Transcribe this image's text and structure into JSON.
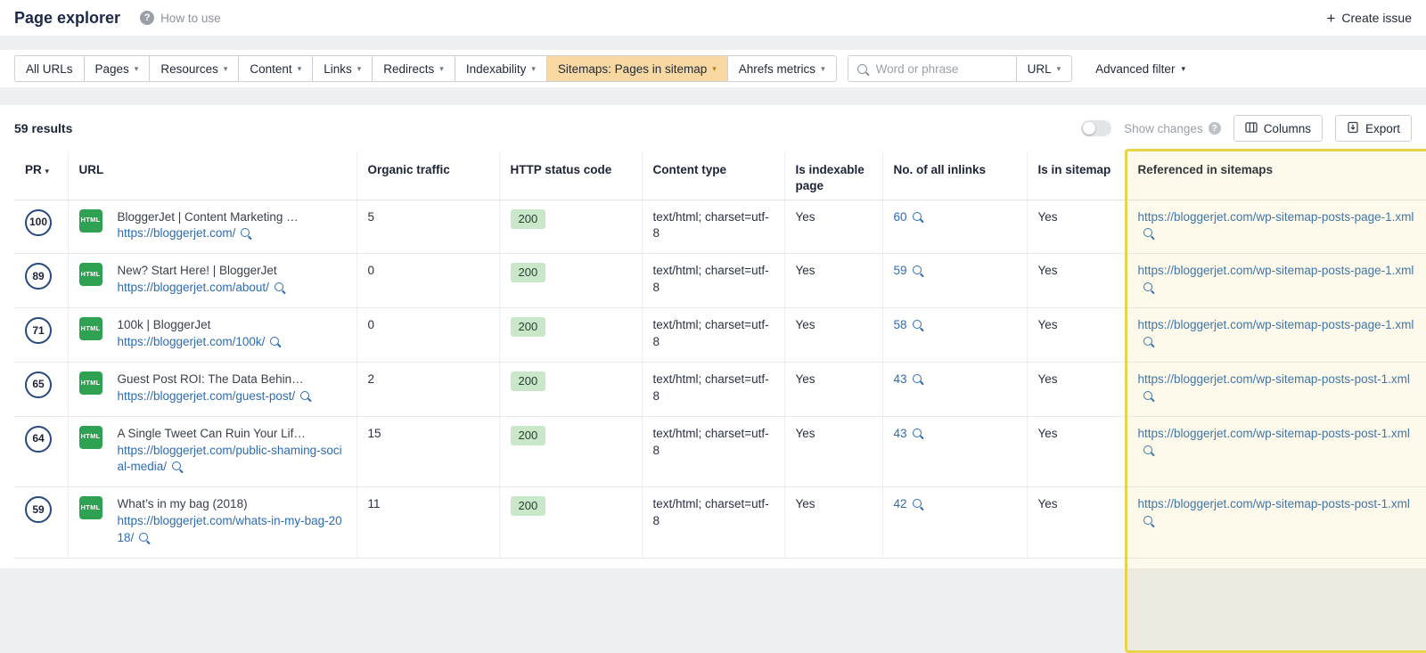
{
  "page": {
    "title": "Page explorer",
    "help_label": "How to use",
    "create_issue_label": "Create issue"
  },
  "filter_bar": {
    "segments": [
      {
        "label": "All URLs",
        "dropdown": false,
        "active": false
      },
      {
        "label": "Pages",
        "dropdown": true,
        "active": false
      },
      {
        "label": "Resources",
        "dropdown": true,
        "active": false
      },
      {
        "label": "Content",
        "dropdown": true,
        "active": false
      },
      {
        "label": "Links",
        "dropdown": true,
        "active": false
      },
      {
        "label": "Redirects",
        "dropdown": true,
        "active": false
      },
      {
        "label": "Indexability",
        "dropdown": true,
        "active": false
      },
      {
        "label": "Sitemaps: Pages in sitemap",
        "dropdown": true,
        "active": true
      },
      {
        "label": "Ahrefs metrics",
        "dropdown": true,
        "active": false
      }
    ],
    "search_placeholder": "Word or phrase",
    "url_scope_label": "URL",
    "advanced_filter_label": "Advanced filter"
  },
  "results_bar": {
    "count": "59 results",
    "show_changes_label": "Show changes",
    "columns_label": "Columns",
    "export_label": "Export"
  },
  "icons": {
    "html_badge": "HTML"
  },
  "colors": {
    "active_filter_bg": "#f8d9a3",
    "status_ok_bg": "#c9e7c9",
    "link_blue": "#2d6cb5",
    "highlight_border": "#e8d44a",
    "html_icon_green": "#2fa152"
  },
  "table": {
    "headers": {
      "pr": "PR",
      "url": "URL",
      "organic_traffic": "Organic traffic",
      "http_status": "HTTP status code",
      "content_type": "Content type",
      "is_indexable": "Is indexable page",
      "inlinks": "No. of all inlinks",
      "in_sitemap": "Is in sitemap",
      "referenced": "Referenced in sitemaps"
    },
    "rows": [
      {
        "pr": "100",
        "title": "BloggerJet | Content Marketing …",
        "url": "https://bloggerjet.com/",
        "traffic": "5",
        "status": "200",
        "content_type": "text/html; charset=utf-8",
        "indexable": "Yes",
        "inlinks": "60",
        "in_sitemap": "Yes",
        "sitemap_url": "https://bloggerjet.com/wp-sitemap-posts-page-1.xml"
      },
      {
        "pr": "89",
        "title": "New? Start Here! | BloggerJet",
        "url": "https://bloggerjet.com/about/",
        "traffic": "0",
        "status": "200",
        "content_type": "text/html; charset=utf-8",
        "indexable": "Yes",
        "inlinks": "59",
        "in_sitemap": "Yes",
        "sitemap_url": "https://bloggerjet.com/wp-sitemap-posts-page-1.xml"
      },
      {
        "pr": "71",
        "title": "100k | BloggerJet",
        "url": "https://bloggerjet.com/100k/",
        "traffic": "0",
        "status": "200",
        "content_type": "text/html; charset=utf-8",
        "indexable": "Yes",
        "inlinks": "58",
        "in_sitemap": "Yes",
        "sitemap_url": "https://bloggerjet.com/wp-sitemap-posts-page-1.xml"
      },
      {
        "pr": "65",
        "title": "Guest Post ROI: The Data Behin…",
        "url": "https://bloggerjet.com/guest-post/",
        "traffic": "2",
        "status": "200",
        "content_type": "text/html; charset=utf-8",
        "indexable": "Yes",
        "inlinks": "43",
        "in_sitemap": "Yes",
        "sitemap_url": "https://bloggerjet.com/wp-sitemap-posts-post-1.xml"
      },
      {
        "pr": "64",
        "title": "A Single Tweet Can Ruin Your Lif…",
        "url": "https://bloggerjet.com/public-shaming-social-media/",
        "traffic": "15",
        "status": "200",
        "content_type": "text/html; charset=utf-8",
        "indexable": "Yes",
        "inlinks": "43",
        "in_sitemap": "Yes",
        "sitemap_url": "https://bloggerjet.com/wp-sitemap-posts-post-1.xml"
      },
      {
        "pr": "59",
        "title": "What’s in my bag (2018)",
        "url": "https://bloggerjet.com/whats-in-my-bag-2018/",
        "traffic": "11",
        "status": "200",
        "content_type": "text/html; charset=utf-8",
        "indexable": "Yes",
        "inlinks": "42",
        "in_sitemap": "Yes",
        "sitemap_url": "https://bloggerjet.com/wp-sitemap-posts-post-1.xml"
      }
    ]
  }
}
